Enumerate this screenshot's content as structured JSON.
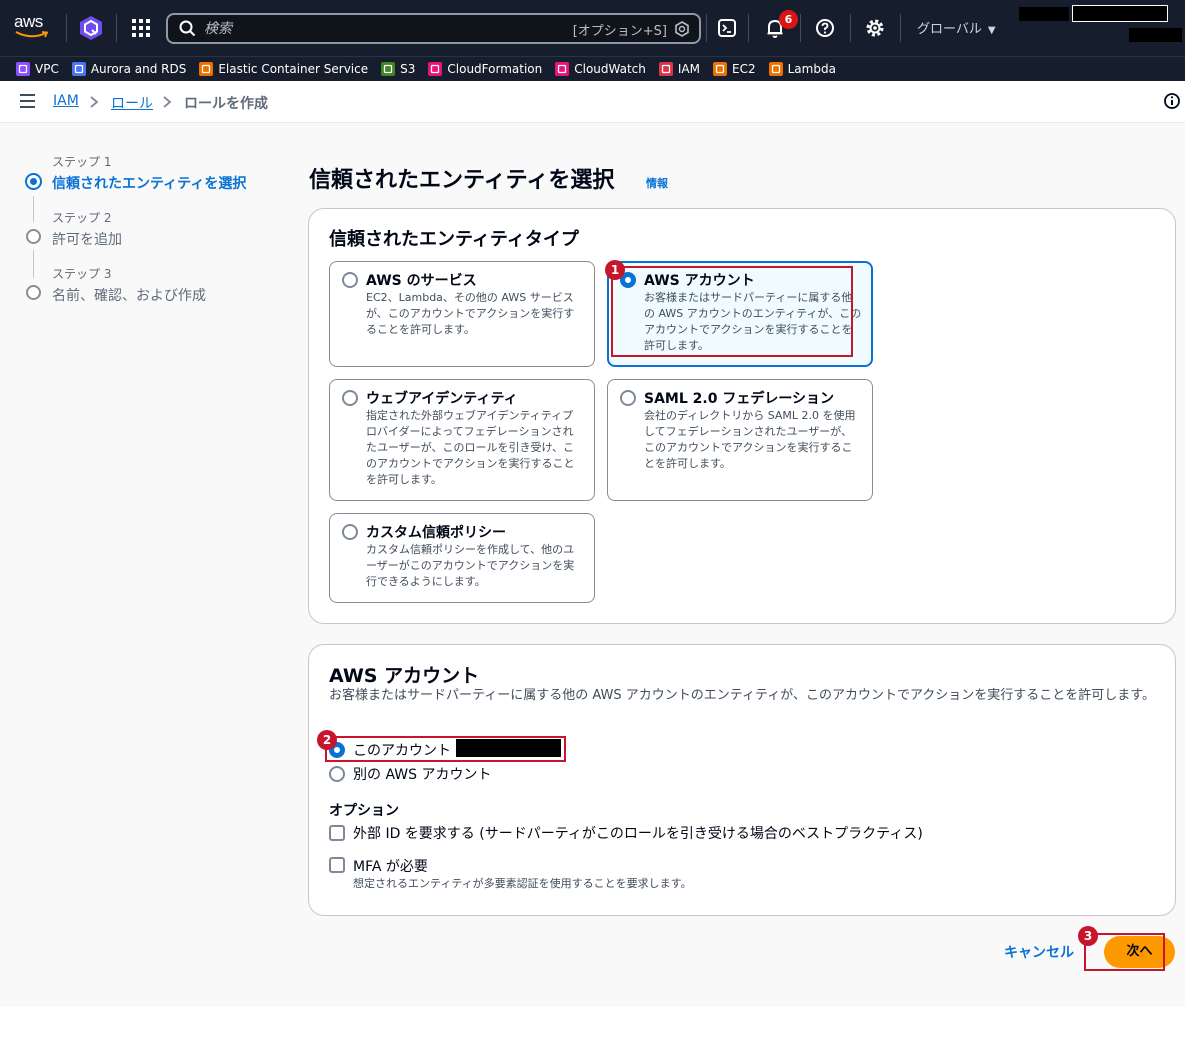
{
  "topnav": {
    "logo": "aws",
    "search_placeholder": "検索",
    "search_shortcut": "[オプション+S]",
    "notification_count": "6",
    "region": "グローバル",
    "colors": {
      "bg": "#161e2d",
      "badge": "#d91515"
    }
  },
  "favorites": [
    {
      "label": "VPC",
      "icon": "vpc-icon",
      "color": "#8c4fff"
    },
    {
      "label": "Aurora and RDS",
      "icon": "rds-icon",
      "color": "#4d72f3"
    },
    {
      "label": "Elastic Container Service",
      "icon": "ecs-icon",
      "color": "#ed7100"
    },
    {
      "label": "S3",
      "icon": "s3-icon",
      "color": "#3f8624"
    },
    {
      "label": "CloudFormation",
      "icon": "cloudformation-icon",
      "color": "#e7157b"
    },
    {
      "label": "CloudWatch",
      "icon": "cloudwatch-icon",
      "color": "#e7157b"
    },
    {
      "label": "IAM",
      "icon": "iam-icon",
      "color": "#dd344c"
    },
    {
      "label": "EC2",
      "icon": "ec2-icon",
      "color": "#ed7100"
    },
    {
      "label": "Lambda",
      "icon": "lambda-icon",
      "color": "#ed7100"
    }
  ],
  "breadcrumb": {
    "iam": "IAM",
    "roles": "ロール",
    "current": "ロールを作成"
  },
  "steps": [
    {
      "label": "ステップ 1",
      "name": "信頼されたエンティティを選択"
    },
    {
      "label": "ステップ 2",
      "name": "許可を追加"
    },
    {
      "label": "ステップ 3",
      "name": "名前、確認、および作成"
    }
  ],
  "page": {
    "title": "信頼されたエンティティを選択",
    "info": "情報"
  },
  "entity_panel": {
    "title": "信頼されたエンティティタイプ",
    "tiles": [
      {
        "title": "AWS のサービス",
        "desc": "EC2、Lambda、その他の AWS サービスが、このアカウントでアクションを実行することを許可します。"
      },
      {
        "title": "AWS アカウント",
        "desc": "お客様またはサードパーティーに属する他の AWS アカウントのエンティティが、このアカウントでアクションを実行することを許可します。"
      },
      {
        "title": "ウェブアイデンティティ",
        "desc": "指定された外部ウェブアイデンティティプロバイダーによってフェデレーションされたユーザーが、このロールを引き受け、このアカウントでアクションを実行することを許可します。"
      },
      {
        "title": "SAML 2.0 フェデレーション",
        "desc": "会社のディレクトリから SAML 2.0 を使用してフェデレーションされたユーザーが、このアカウントでアクションを実行することを許可します。"
      },
      {
        "title": "カスタム信頼ポリシー",
        "desc": "カスタム信頼ポリシーを作成して、他のユーザーがこのアカウントでアクションを実行できるようにします。"
      }
    ]
  },
  "account_panel": {
    "title": "AWS アカウント",
    "desc": "お客様またはサードパーティーに属する他の AWS アカウントのエンティティが、このアカウントでアクションを実行することを許可します。",
    "opt_this": "このアカウント (",
    "opt_other": "別の AWS アカウント",
    "options_title": "オプション",
    "external_id": "外部 ID を要求する (サードパーティがこのロールを引き受ける場合のベストプラクティス)",
    "mfa": "MFA が必要",
    "mfa_desc": "想定されるエンティティが多要素認証を使用することを要求します。"
  },
  "footer": {
    "cancel": "キャンセル",
    "next": "次へ"
  },
  "annotations": [
    "1",
    "2",
    "3"
  ],
  "accent": "#0972d3",
  "highlight": "#c7162b"
}
